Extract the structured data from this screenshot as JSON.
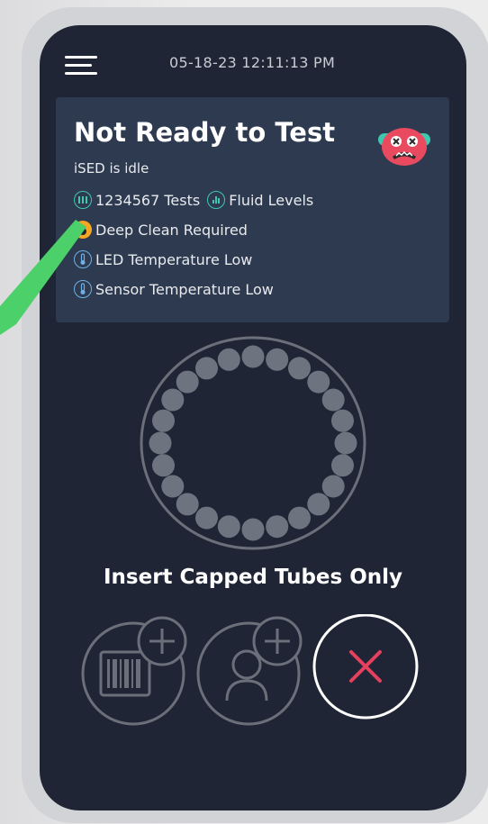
{
  "header": {
    "datetime": "05-18-23 12:11:13 PM"
  },
  "status": {
    "title": "Not Ready to Test",
    "subtitle": "iSED is idle",
    "items": [
      {
        "label": "1234567 Tests",
        "icon": "test-tubes-icon"
      },
      {
        "label": "Fluid Levels",
        "icon": "fluid-levels-icon"
      },
      {
        "label": "Deep Clean Required",
        "icon": "drop-icon"
      },
      {
        "label": "LED Temperature Low",
        "icon": "thermometer-icon"
      },
      {
        "label": "Sensor Temperature Low",
        "icon": "thermometer-icon"
      }
    ]
  },
  "carousel": {
    "slot_count": 24
  },
  "instruction": "Insert Capped Tubes Only",
  "colors": {
    "screen_bg": "#1f2535",
    "card_bg": "#2d3a4f",
    "teal": "#3fc7b0",
    "blue": "#6fb0e6",
    "orange": "#f5a623",
    "cancel_red": "#e5405e",
    "callout_green": "#4cd06a",
    "mascot_red": "#e94a5f"
  }
}
